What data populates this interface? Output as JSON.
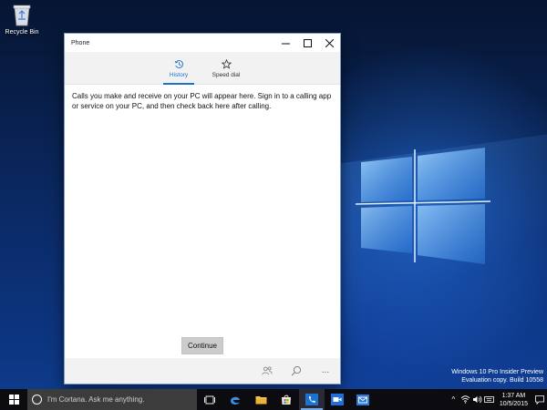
{
  "desktop": {
    "recycle_bin_label": "Recycle Bin",
    "watermark": {
      "line1": "Windows 10 Pro Insider Preview",
      "line2": "Evaluation copy. Build 10558"
    }
  },
  "window": {
    "title": "Phone",
    "controls": {
      "minimize": "—",
      "maximize": "☐",
      "close": "✕"
    },
    "tabs": [
      {
        "label": "History",
        "icon": "history-icon",
        "active": true
      },
      {
        "label": "Speed dial",
        "icon": "star-icon",
        "active": false
      }
    ],
    "message": "Calls you make and receive on your PC will appear here. Sign in to a calling app or service on your PC, and then check back here after calling.",
    "continue_label": "Continue",
    "appbar": {
      "contacts_icon": "contacts-icon",
      "search_icon": "search-icon",
      "more_glyph": "..."
    }
  },
  "taskbar": {
    "cortana_placeholder": "I'm Cortana. Ask me anything.",
    "apps": [
      "task-view-icon",
      "edge-icon",
      "file-explorer-icon",
      "store-icon",
      "phone-icon",
      "skype-video-icon",
      "mail-icon"
    ],
    "tray": {
      "chevron": "^",
      "time": "1:37 AM",
      "date": "10/5/2015"
    }
  },
  "colors": {
    "accent": "#1a73d1",
    "taskbar": "#0c0c10",
    "window_bg": "#ffffff",
    "tabs_bg": "#f2f2f2"
  }
}
